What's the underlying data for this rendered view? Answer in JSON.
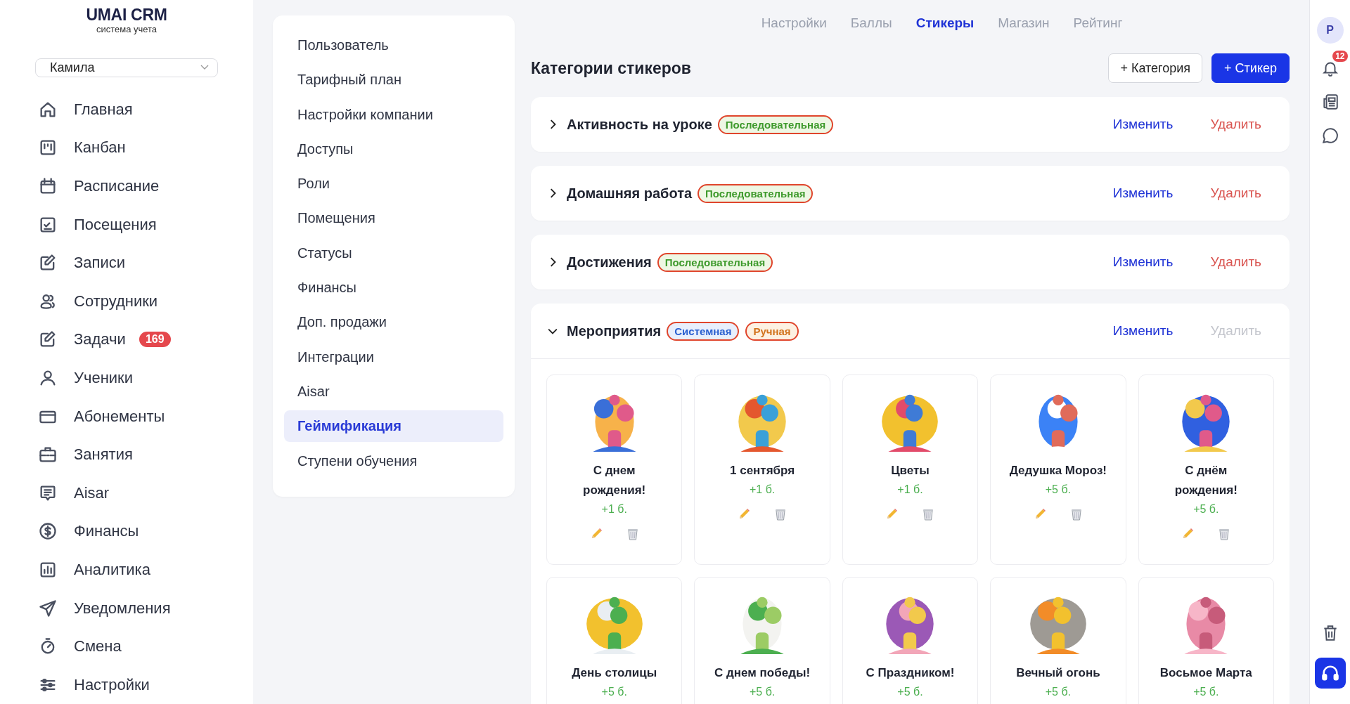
{
  "sidebar": {
    "logo": {
      "title": "UMAI CRM",
      "subtitle": "система учета"
    },
    "user_select": {
      "value": "Камила"
    },
    "items": [
      {
        "label": "Главная"
      },
      {
        "label": "Канбан"
      },
      {
        "label": "Расписание"
      },
      {
        "label": "Посещения"
      },
      {
        "label": "Записи"
      },
      {
        "label": "Сотрудники"
      },
      {
        "label": "Задачи",
        "badge": "169"
      },
      {
        "label": "Ученики"
      },
      {
        "label": "Абонементы"
      },
      {
        "label": "Занятия"
      },
      {
        "label": "Aisar"
      },
      {
        "label": "Финансы"
      },
      {
        "label": "Аналитика"
      },
      {
        "label": "Уведомления"
      },
      {
        "label": "Смена"
      },
      {
        "label": "Настройки"
      }
    ]
  },
  "settings_menu": {
    "items": [
      {
        "label": "Пользователь",
        "selected": false
      },
      {
        "label": "Тарифный план",
        "selected": false
      },
      {
        "label": "Настройки компании",
        "selected": false
      },
      {
        "label": "Доступы",
        "selected": false
      },
      {
        "label": "Роли",
        "selected": false
      },
      {
        "label": "Помещения",
        "selected": false
      },
      {
        "label": "Статусы",
        "selected": false
      },
      {
        "label": "Финансы",
        "selected": false
      },
      {
        "label": "Доп. продажи",
        "selected": false
      },
      {
        "label": "Интеграции",
        "selected": false
      },
      {
        "label": "Aisar",
        "selected": false
      },
      {
        "label": "Геймификация",
        "selected": true
      },
      {
        "label": "Ступени обучения",
        "selected": false
      }
    ]
  },
  "tabs": [
    {
      "label": "Настройки",
      "selected": false
    },
    {
      "label": "Баллы",
      "selected": false
    },
    {
      "label": "Стикеры",
      "selected": true
    },
    {
      "label": "Магазин",
      "selected": false
    },
    {
      "label": "Рейтинг",
      "selected": false
    }
  ],
  "page_title": "Категории стикеров",
  "actions": [
    {
      "label": "+ Категория",
      "kind": "secondary"
    },
    {
      "label": "+ Стикер",
      "kind": "primary"
    }
  ],
  "categories": [
    {
      "name": "Активность на уроке",
      "expanded": false,
      "badges": [
        {
          "label": "Последовательная",
          "kind": "sequential"
        }
      ],
      "edit": "Изменить",
      "delete": {
        "label": "Удалить",
        "disabled": false
      }
    },
    {
      "name": "Домашняя работа",
      "expanded": false,
      "badges": [
        {
          "label": "Последовательная",
          "kind": "sequential"
        }
      ],
      "edit": "Изменить",
      "delete": {
        "label": "Удалить",
        "disabled": false
      }
    },
    {
      "name": "Достижения",
      "expanded": false,
      "badges": [
        {
          "label": "Последовательная",
          "kind": "sequential"
        }
      ],
      "edit": "Изменить",
      "delete": {
        "label": "Удалить",
        "disabled": false
      }
    },
    {
      "name": "Мероприятия",
      "expanded": true,
      "badges": [
        {
          "label": "Системная",
          "kind": "system"
        },
        {
          "label": "Ручная",
          "kind": "manual"
        }
      ],
      "edit": "Изменить",
      "delete": {
        "label": "Удалить",
        "disabled": true
      },
      "stickers": [
        {
          "name": "С днем рождения!",
          "points": "+1 б.",
          "kind": "picture",
          "actions": true
        },
        {
          "name": "1 сентября",
          "points": "+1 б.",
          "kind": "picture",
          "actions": true
        },
        {
          "name": "Цветы",
          "points": "+1 б.",
          "kind": "picture",
          "actions": true
        },
        {
          "name": "Дедушка Мороз!",
          "points": "+5 б.",
          "kind": "picture",
          "actions": true
        },
        {
          "name": "С днём рождения!",
          "points": "+5 б.",
          "kind": "picture",
          "actions": true
        },
        {
          "name": "День столицы",
          "points": "+5 б.",
          "kind": "picture"
        },
        {
          "name": "С днем победы!",
          "points": "+5 б.",
          "kind": "picture"
        },
        {
          "name": "С Праздником!",
          "points": "+5 б.",
          "kind": "picture"
        },
        {
          "name": "Вечный огонь",
          "points": "+5 б.",
          "kind": "picture"
        },
        {
          "name": "Восьмое Марта",
          "points": "+5 б.",
          "kind": "picture"
        }
      ]
    }
  ],
  "right_rail": {
    "avatar": "Р",
    "notifications": "12"
  }
}
